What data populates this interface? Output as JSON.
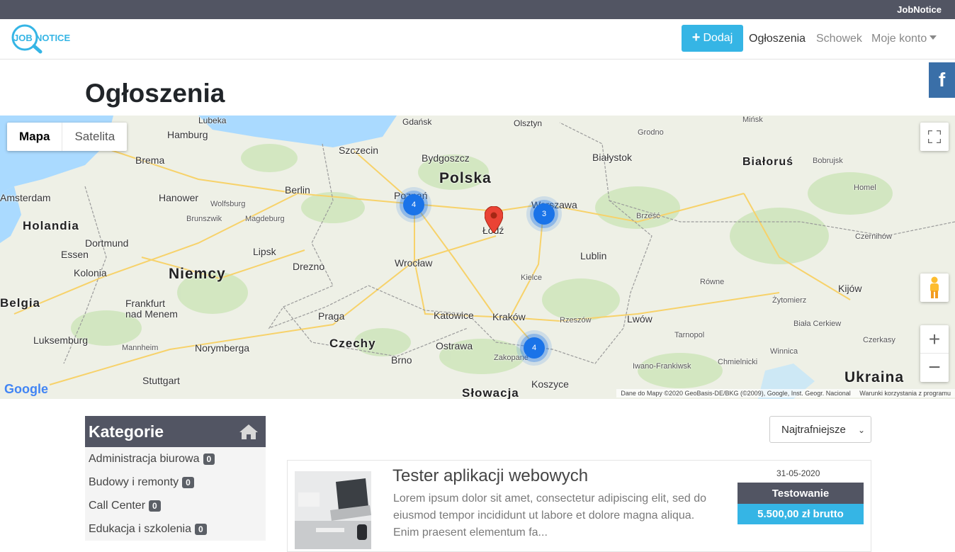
{
  "topbar": {
    "brand": "JobNotice"
  },
  "navbar": {
    "logo_text_a": "JOB",
    "logo_text_b": "NOTICE",
    "add_label": "Dodaj",
    "links": [
      "Ogłoszenia",
      "Schowek",
      "Moje konto"
    ]
  },
  "social": {
    "facebook": "f"
  },
  "page": {
    "title": "Ogłoszenia"
  },
  "map": {
    "type_map": "Mapa",
    "type_satellite": "Satelita",
    "google": "Google",
    "attribution": "Dane do Mapy ©2020 GeoBasis-DE/BKG (©2009), Google, Inst. Geogr. Nacional",
    "terms": "Warunki korzystania z programu",
    "countries": [
      "Polska",
      "Niemcy",
      "Czechy",
      "Białoruś",
      "Holandia",
      "Belgia",
      "Ukraina",
      "Słowacja"
    ],
    "cities": [
      "Olsztyn",
      "Grodno",
      "Gdańsk",
      "Mińsk",
      "Lubeka",
      "Hamburg",
      "Szczecin",
      "Bydgoszcz",
      "Białystok",
      "Brema",
      "Amsterdam",
      "Hanower",
      "Wolfsburg",
      "Berlin",
      "Poznań",
      "Warszawa",
      "Brunszwik",
      "Magdeburg",
      "Brześć",
      "Bobrujsk",
      "Homel",
      "Łódź",
      "Dortmund",
      "Essen",
      "Lipsk",
      "Lublin",
      "Czernihów",
      "Kolonia",
      "Wrocław",
      "Drezno",
      "Kielce",
      "Równe",
      "Kijów",
      "Frankfurt nad Menem",
      "Praga",
      "Katowice",
      "Kraków",
      "Rzeszów",
      "Lwów",
      "Żytomierz",
      "Tarnopol",
      "Biała Cerkiew",
      "Luksemburg",
      "Mannheim",
      "Norymberga",
      "Ostrawa",
      "Brno",
      "Zakopane",
      "Winnica",
      "Czerkasy",
      "Iwano-Frankiwsk",
      "Chmielnicki",
      "Stuttgart",
      "Koszyce"
    ],
    "clusters": [
      {
        "label": "4",
        "near": "Poznań"
      },
      {
        "label": "3",
        "near": "Warszawa"
      },
      {
        "label": "4",
        "near": "Zakopane"
      }
    ]
  },
  "categories": {
    "title": "Kategorie",
    "items": [
      {
        "label": "Administracja biurowa",
        "count": "0"
      },
      {
        "label": "Budowy i remonty",
        "count": "0"
      },
      {
        "label": "Call Center",
        "count": "0"
      },
      {
        "label": "Edukacja i szkolenia",
        "count": "0"
      }
    ]
  },
  "sort": {
    "selected": "Najtrafniejsze"
  },
  "jobs": [
    {
      "title": "Tester aplikacji webowych",
      "description": "Lorem ipsum dolor sit amet, consectetur adipiscing elit, sed do eiusmod tempor incididunt ut labore et dolore magna aliqua. Enim praesent elementum fa...",
      "date": "31-05-2020",
      "category": "Testowanie",
      "salary": "5.500,00 zł brutto"
    }
  ],
  "colors": {
    "accent": "#35b5e5",
    "dark": "#525563",
    "facebook": "#3a6fa8",
    "cluster": "#1a73e8",
    "pin": "#ea4335"
  }
}
